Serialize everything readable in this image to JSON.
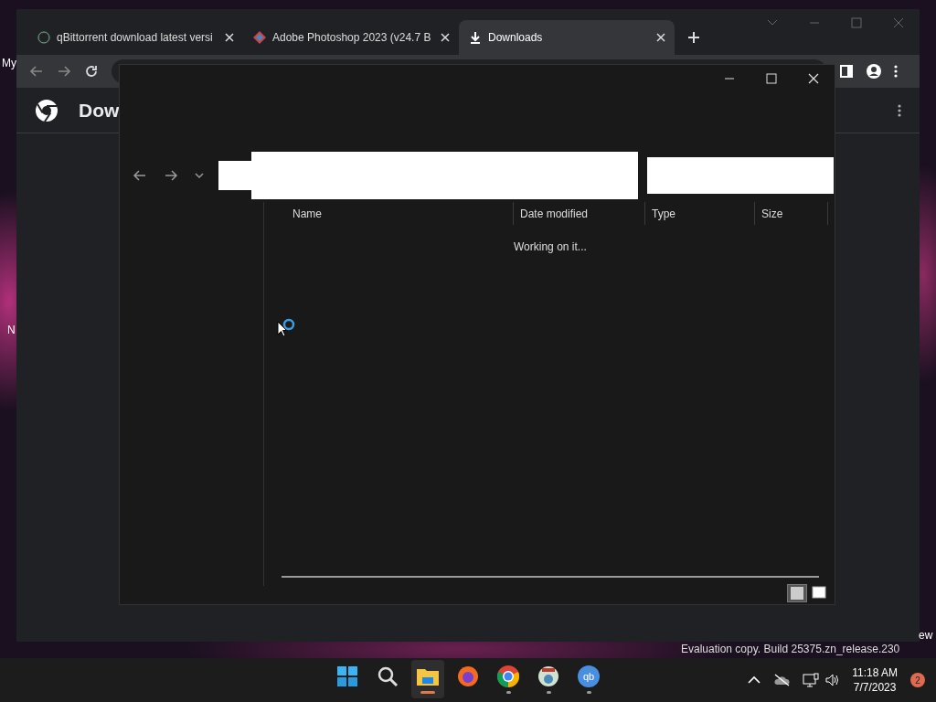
{
  "desktop": {
    "icon_labels": [
      "My",
      "N",
      "ew"
    ],
    "build_text": "Evaluation copy. Build 25375.zn_release.230"
  },
  "browser": {
    "tabs": [
      {
        "title": "qBittorrent download latest versi",
        "kind": "ring",
        "selected": false
      },
      {
        "title": "Adobe Photoshop 2023 (v24.7 B",
        "kind": "colorful",
        "selected": false
      },
      {
        "title": "Downloads",
        "kind": "download",
        "selected": true
      }
    ],
    "page_title": "Dow"
  },
  "dialog": {
    "columns": [
      "Name",
      "Date modified",
      "Type",
      "Size"
    ],
    "status": "Working on it...",
    "views": [
      {
        "kind": "details",
        "selected": true
      },
      {
        "kind": "preview",
        "selected": false
      }
    ]
  },
  "taskbar": {
    "apps": [
      {
        "kind": "start",
        "running": false,
        "focused": false
      },
      {
        "kind": "search",
        "running": false,
        "focused": false
      },
      {
        "kind": "folder",
        "running": true,
        "focused": true
      },
      {
        "kind": "firefox",
        "running": false,
        "focused": false
      },
      {
        "kind": "chrome",
        "running": true,
        "focused": false
      },
      {
        "kind": "globe",
        "running": true,
        "focused": false
      },
      {
        "kind": "qb",
        "running": true,
        "focused": false
      }
    ],
    "time": "11:18 AM",
    "date": "7/7/2023",
    "notification_count": "2"
  }
}
